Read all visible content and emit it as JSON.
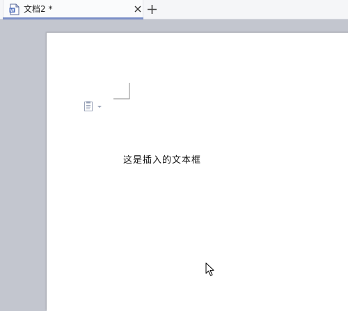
{
  "tabbar": {
    "tab": {
      "title": "文档2 *"
    }
  },
  "document": {
    "body_text": "这是插入的文本框"
  },
  "icons": {
    "doc_icon": "document-icon",
    "close_icon": "close-icon",
    "new_tab_icon": "plus-icon",
    "paste_options_icon": "paste-options-icon",
    "cursor_icon": "mouse-pointer-icon"
  },
  "colors": {
    "tab_accent": "#7b8fc7",
    "workspace_bg": "#c3c6cf",
    "page_bg": "#ffffff"
  }
}
